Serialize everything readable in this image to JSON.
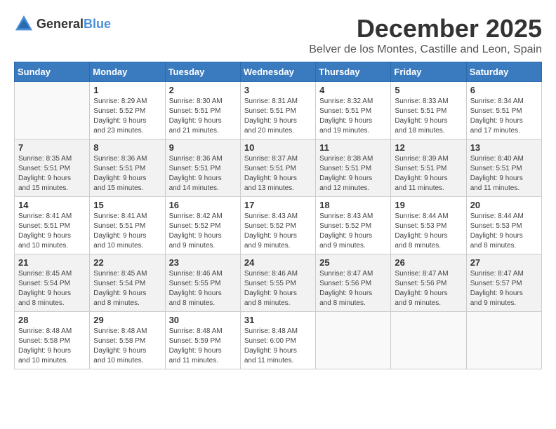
{
  "logo": {
    "general": "General",
    "blue": "Blue"
  },
  "title": "December 2025",
  "location": "Belver de los Montes, Castille and Leon, Spain",
  "days_of_week": [
    "Sunday",
    "Monday",
    "Tuesday",
    "Wednesday",
    "Thursday",
    "Friday",
    "Saturday"
  ],
  "weeks": [
    {
      "shaded": false,
      "days": [
        {
          "num": "",
          "info": ""
        },
        {
          "num": "1",
          "info": "Sunrise: 8:29 AM\nSunset: 5:52 PM\nDaylight: 9 hours\nand 23 minutes."
        },
        {
          "num": "2",
          "info": "Sunrise: 8:30 AM\nSunset: 5:51 PM\nDaylight: 9 hours\nand 21 minutes."
        },
        {
          "num": "3",
          "info": "Sunrise: 8:31 AM\nSunset: 5:51 PM\nDaylight: 9 hours\nand 20 minutes."
        },
        {
          "num": "4",
          "info": "Sunrise: 8:32 AM\nSunset: 5:51 PM\nDaylight: 9 hours\nand 19 minutes."
        },
        {
          "num": "5",
          "info": "Sunrise: 8:33 AM\nSunset: 5:51 PM\nDaylight: 9 hours\nand 18 minutes."
        },
        {
          "num": "6",
          "info": "Sunrise: 8:34 AM\nSunset: 5:51 PM\nDaylight: 9 hours\nand 17 minutes."
        }
      ]
    },
    {
      "shaded": true,
      "days": [
        {
          "num": "7",
          "info": "Sunrise: 8:35 AM\nSunset: 5:51 PM\nDaylight: 9 hours\nand 15 minutes."
        },
        {
          "num": "8",
          "info": "Sunrise: 8:36 AM\nSunset: 5:51 PM\nDaylight: 9 hours\nand 15 minutes."
        },
        {
          "num": "9",
          "info": "Sunrise: 8:36 AM\nSunset: 5:51 PM\nDaylight: 9 hours\nand 14 minutes."
        },
        {
          "num": "10",
          "info": "Sunrise: 8:37 AM\nSunset: 5:51 PM\nDaylight: 9 hours\nand 13 minutes."
        },
        {
          "num": "11",
          "info": "Sunrise: 8:38 AM\nSunset: 5:51 PM\nDaylight: 9 hours\nand 12 minutes."
        },
        {
          "num": "12",
          "info": "Sunrise: 8:39 AM\nSunset: 5:51 PM\nDaylight: 9 hours\nand 11 minutes."
        },
        {
          "num": "13",
          "info": "Sunrise: 8:40 AM\nSunset: 5:51 PM\nDaylight: 9 hours\nand 11 minutes."
        }
      ]
    },
    {
      "shaded": false,
      "days": [
        {
          "num": "14",
          "info": "Sunrise: 8:41 AM\nSunset: 5:51 PM\nDaylight: 9 hours\nand 10 minutes."
        },
        {
          "num": "15",
          "info": "Sunrise: 8:41 AM\nSunset: 5:51 PM\nDaylight: 9 hours\nand 10 minutes."
        },
        {
          "num": "16",
          "info": "Sunrise: 8:42 AM\nSunset: 5:52 PM\nDaylight: 9 hours\nand 9 minutes."
        },
        {
          "num": "17",
          "info": "Sunrise: 8:43 AM\nSunset: 5:52 PM\nDaylight: 9 hours\nand 9 minutes."
        },
        {
          "num": "18",
          "info": "Sunrise: 8:43 AM\nSunset: 5:52 PM\nDaylight: 9 hours\nand 9 minutes."
        },
        {
          "num": "19",
          "info": "Sunrise: 8:44 AM\nSunset: 5:53 PM\nDaylight: 9 hours\nand 8 minutes."
        },
        {
          "num": "20",
          "info": "Sunrise: 8:44 AM\nSunset: 5:53 PM\nDaylight: 9 hours\nand 8 minutes."
        }
      ]
    },
    {
      "shaded": true,
      "days": [
        {
          "num": "21",
          "info": "Sunrise: 8:45 AM\nSunset: 5:54 PM\nDaylight: 9 hours\nand 8 minutes."
        },
        {
          "num": "22",
          "info": "Sunrise: 8:45 AM\nSunset: 5:54 PM\nDaylight: 9 hours\nand 8 minutes."
        },
        {
          "num": "23",
          "info": "Sunrise: 8:46 AM\nSunset: 5:55 PM\nDaylight: 9 hours\nand 8 minutes."
        },
        {
          "num": "24",
          "info": "Sunrise: 8:46 AM\nSunset: 5:55 PM\nDaylight: 9 hours\nand 8 minutes."
        },
        {
          "num": "25",
          "info": "Sunrise: 8:47 AM\nSunset: 5:56 PM\nDaylight: 9 hours\nand 8 minutes."
        },
        {
          "num": "26",
          "info": "Sunrise: 8:47 AM\nSunset: 5:56 PM\nDaylight: 9 hours\nand 9 minutes."
        },
        {
          "num": "27",
          "info": "Sunrise: 8:47 AM\nSunset: 5:57 PM\nDaylight: 9 hours\nand 9 minutes."
        }
      ]
    },
    {
      "shaded": false,
      "days": [
        {
          "num": "28",
          "info": "Sunrise: 8:48 AM\nSunset: 5:58 PM\nDaylight: 9 hours\nand 10 minutes."
        },
        {
          "num": "29",
          "info": "Sunrise: 8:48 AM\nSunset: 5:58 PM\nDaylight: 9 hours\nand 10 minutes."
        },
        {
          "num": "30",
          "info": "Sunrise: 8:48 AM\nSunset: 5:59 PM\nDaylight: 9 hours\nand 11 minutes."
        },
        {
          "num": "31",
          "info": "Sunrise: 8:48 AM\nSunset: 6:00 PM\nDaylight: 9 hours\nand 11 minutes."
        },
        {
          "num": "",
          "info": ""
        },
        {
          "num": "",
          "info": ""
        },
        {
          "num": "",
          "info": ""
        }
      ]
    }
  ]
}
